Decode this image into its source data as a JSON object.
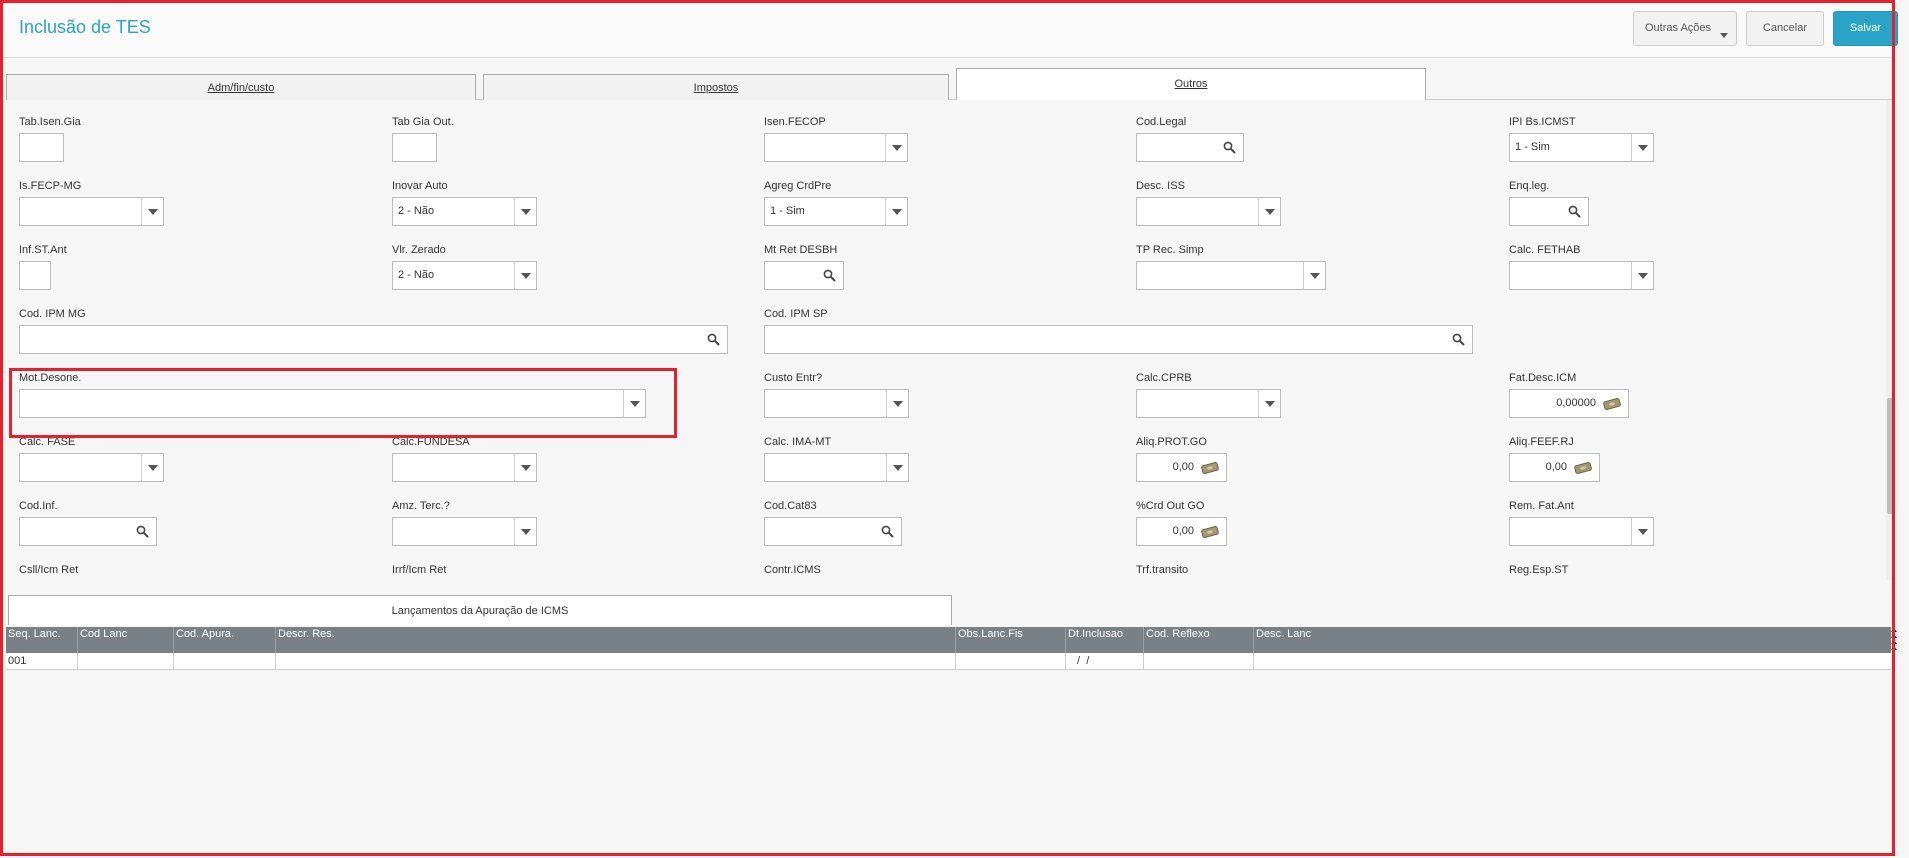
{
  "header": {
    "title": "Inclusão de TES",
    "buttons": {
      "more": "Outras Ações",
      "cancel": "Cancelar",
      "save": "Salvar"
    }
  },
  "tabs": [
    {
      "label": "Adm/fin/custo",
      "active": false
    },
    {
      "label": "Impostos",
      "active": false
    },
    {
      "label": "Outros",
      "active": true
    }
  ],
  "form": {
    "tab_isen_gia": {
      "label": "Tab.Isen.Gia",
      "value": ""
    },
    "tab_gia_out": {
      "label": "Tab Gia Out.",
      "value": ""
    },
    "isen_fecop": {
      "label": "Isen.FECOP",
      "value": ""
    },
    "cod_legal": {
      "label": "Cod.Legal",
      "value": ""
    },
    "ipi_bs_icmst": {
      "label": "IPI Bs.ICMST",
      "value": "1 - Sim"
    },
    "is_fecp_mg": {
      "label": "Is.FECP-MG",
      "value": ""
    },
    "inovar_auto": {
      "label": "Inovar Auto",
      "value": "2 - Não"
    },
    "agreg_crdpre": {
      "label": "Agreg CrdPre",
      "value": "1 - Sim"
    },
    "desc_iss": {
      "label": "Desc. ISS",
      "value": ""
    },
    "enq_leg": {
      "label": "Enq.leg.",
      "value": ""
    },
    "inf_st_ant": {
      "label": "Inf.ST.Ant",
      "value": ""
    },
    "vlr_zerado": {
      "label": "Vlr. Zerado",
      "value": "2 - Não"
    },
    "mt_ret_desbh": {
      "label": "Mt Ret DESBH",
      "value": ""
    },
    "tp_rec_simp": {
      "label": "TP Rec. Simp",
      "value": ""
    },
    "calc_fethab": {
      "label": "Calc. FETHAB",
      "value": ""
    },
    "cod_ipm_mg": {
      "label": "Cod. IPM MG",
      "value": ""
    },
    "cod_ipm_sp": {
      "label": "Cod. IPM SP",
      "value": ""
    },
    "mot_desone": {
      "label": "Mot.Desone.",
      "value": ""
    },
    "custo_entr": {
      "label": "Custo Entr?",
      "value": ""
    },
    "calc_cprb": {
      "label": "Calc.CPRB",
      "value": ""
    },
    "fat_desc_icm": {
      "label": "Fat.Desc.ICM",
      "value": "0,00000"
    },
    "calc_fase": {
      "label": "Calc. FASE",
      "value": ""
    },
    "calc_fundesa": {
      "label": "Calc.FUNDESA",
      "value": ""
    },
    "calc_ima_mt": {
      "label": "Calc. IMA-MT",
      "value": ""
    },
    "aliq_prot_go": {
      "label": "Aliq.PROT.GO",
      "value": "0,00"
    },
    "aliq_feef_rj": {
      "label": "Aliq.FEEF.RJ",
      "value": "0,00"
    },
    "cod_inf": {
      "label": "Cod.Inf.",
      "value": ""
    },
    "amz_terc": {
      "label": "Amz. Terc.?",
      "value": ""
    },
    "cod_cat83": {
      "label": "Cod.Cat83",
      "value": ""
    },
    "crd_out_go": {
      "label": "%Crd Out GO",
      "value": "0,00"
    },
    "rem_fat_ant": {
      "label": "Rem. Fat.Ant",
      "value": ""
    },
    "csll_icm_ret": {
      "label": "Csll/Icm Ret"
    },
    "irrf_icm_ret": {
      "label": "Irrf/Icm Ret"
    },
    "contr_icms": {
      "label": "Contr.ICMS"
    },
    "trf_transito": {
      "label": "Trf.transito"
    },
    "reg_esp_st": {
      "label": "Reg.Esp.ST"
    }
  },
  "lower_tab": {
    "label": "Lançamentos da Apuração de ICMS"
  },
  "grid": {
    "columns": [
      "Seq. Lanc.",
      "Cod Lanc",
      "Cod. Apura.",
      "Descr. Res.",
      "Obs.Lanc.Fis",
      "Dt.Inclusao",
      "Cod. Reflexo",
      "Desc. Lanc"
    ],
    "rows": [
      [
        "001",
        "",
        "",
        "",
        "",
        " /  /",
        "",
        ""
      ]
    ]
  },
  "colors": {
    "accent": "#29a3c8",
    "highlight": "#e3222b",
    "grid_header": "#7a8186"
  }
}
